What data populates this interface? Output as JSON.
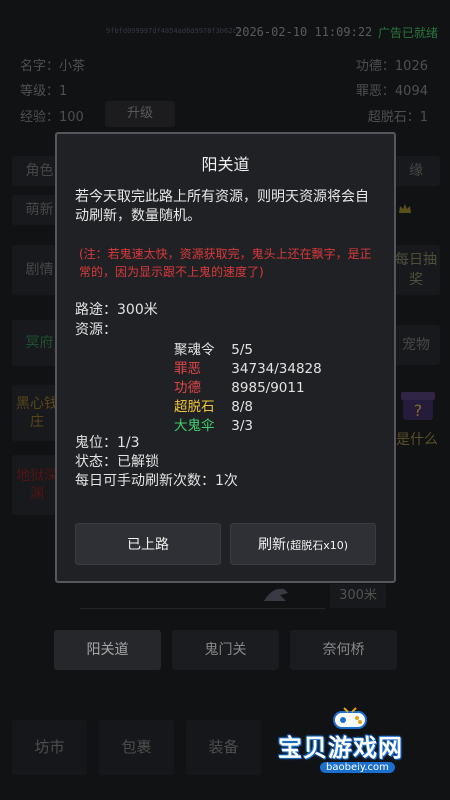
{
  "topbar": {
    "uid": "9fbfd099997df4854ad6d9978f3b62c1",
    "time": "2026-02-10  11:09:22",
    "ad_status": "广告已就绪"
  },
  "player": {
    "name_label": "名字：小茶",
    "level_label": "等级：1",
    "exp_label": "经验：100",
    "merit_label": "功德：1026",
    "sin_label": "罪恶：4094",
    "transcend_label": "超脱石：1",
    "upgrade_button": "升级"
  },
  "background": {
    "left_buttons": [
      "角色",
      "萌新",
      "剧情",
      "冥府",
      "黑心钱庄",
      "地狱深渊"
    ],
    "right_buttons": [
      "缘",
      "每日抽奖",
      "宠物",
      "是什么"
    ]
  },
  "modal": {
    "title": "阳关道",
    "description": "若今天取完此路上所有资源，则明天资源将会自动刷新，数量随机。",
    "note": "(注：若鬼速太快，资源获取完，鬼头上还在飘字，是正常的，因为显示跟不上鬼的速度了)",
    "route_label": "路途：300米",
    "resources_label": "资源：",
    "resources": [
      {
        "name": "聚魂令",
        "value": "5/5",
        "color": "#e2e2e2"
      },
      {
        "name": "罪恶",
        "value": "34734/34828",
        "color": "#e04545"
      },
      {
        "name": "功德",
        "value": "8985/9011",
        "color": "#e04545"
      },
      {
        "name": "超脱石",
        "value": "8/8",
        "color": "#f0c43a"
      },
      {
        "name": "大鬼伞",
        "value": "3/3",
        "color": "#3fd16a"
      }
    ],
    "ghost_slot": "鬼位：1/3",
    "status": "状态：已解锁",
    "refresh_count": "每日可手动刷新次数：1次",
    "btn_on_road": "已上路",
    "btn_refresh": "刷新",
    "btn_refresh_cost": "(超脱石x10)"
  },
  "distance": "300米",
  "tabs": [
    "阳关道",
    "鬼门关",
    "奈何桥"
  ],
  "nav": [
    "坊市",
    "包裹",
    "装备"
  ],
  "watermark": {
    "name": "宝贝游戏网",
    "url": "baobeiy.com"
  }
}
